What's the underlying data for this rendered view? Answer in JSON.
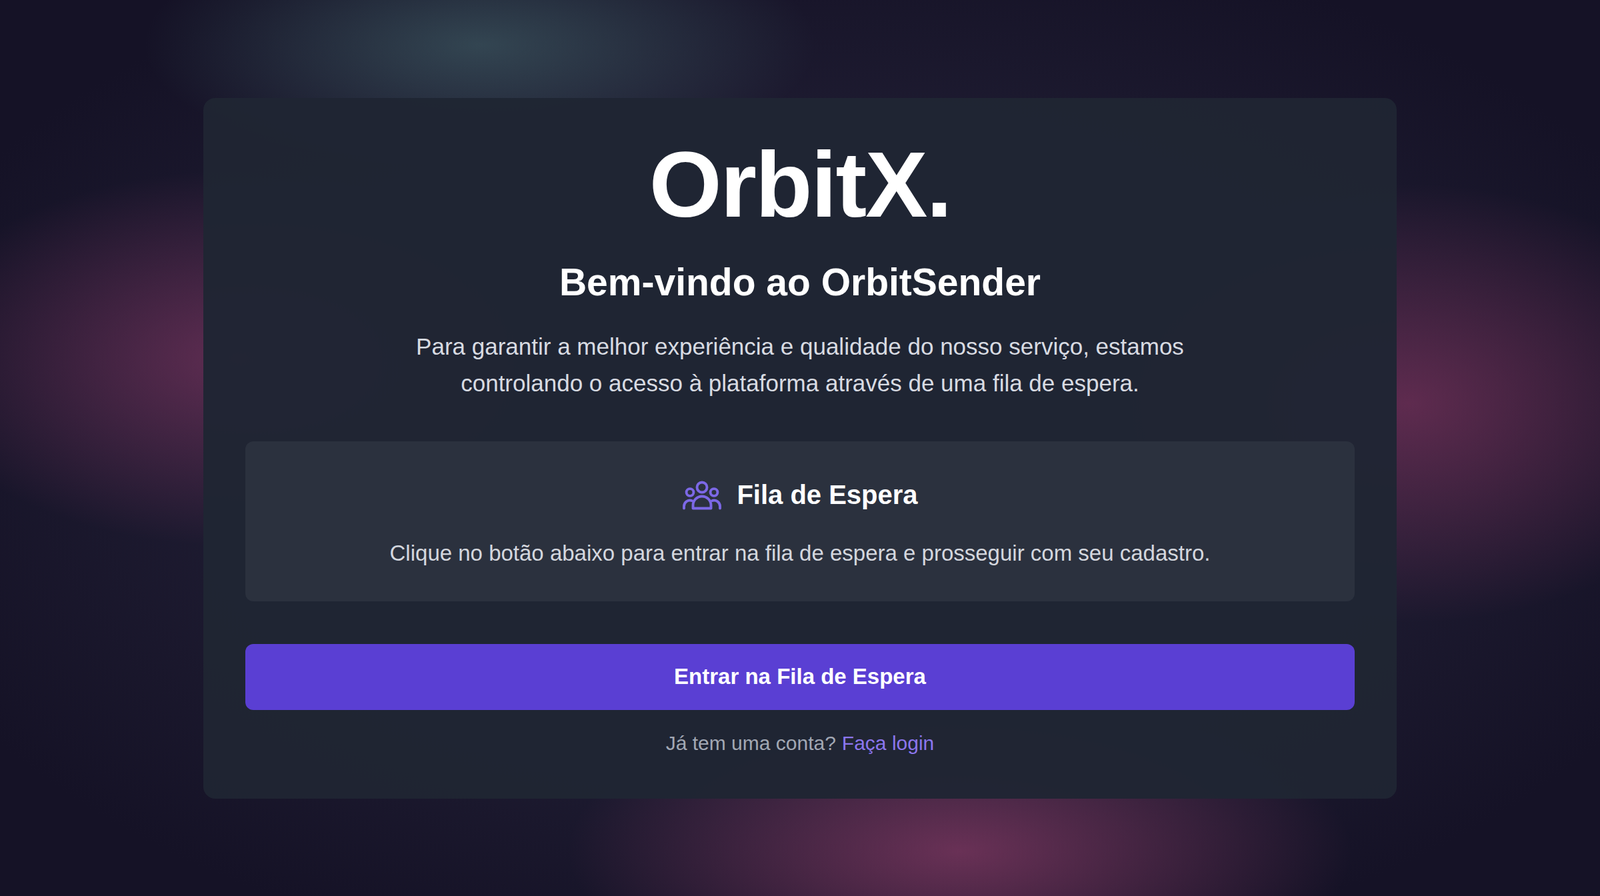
{
  "logo": "OrbitX.",
  "title": "Bem-vindo ao OrbitSender",
  "description": "Para garantir a melhor experiência e qualidade do nosso serviço, estamos controlando o acesso à plataforma através de uma fila de espera.",
  "queue": {
    "title": "Fila de Espera",
    "text": "Clique no botão abaixo para entrar na fila de espera e prosseguir com seu cadastro."
  },
  "button": "Entrar na Fila de Espera",
  "login": {
    "prompt": "Já tem uma conta?",
    "link": "Faça login"
  }
}
